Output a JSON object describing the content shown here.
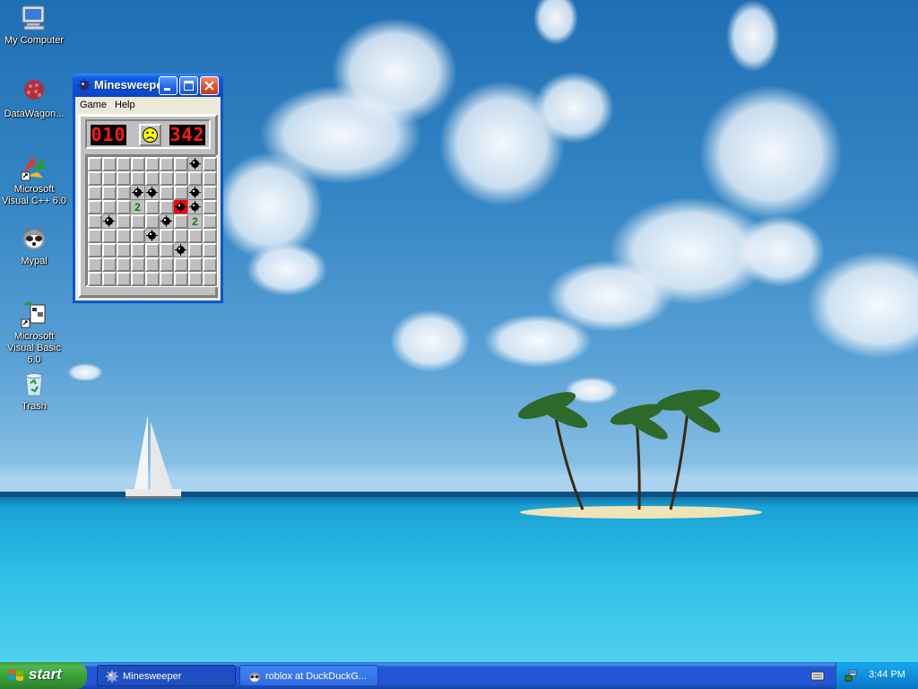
{
  "desktop": {
    "icons": [
      {
        "label": "My Computer",
        "icon": "my-computer-icon"
      },
      {
        "label": "DataWagon...",
        "icon": "datawagon-icon"
      },
      {
        "label": "Microsoft Visual C++ 6.0",
        "icon": "visual-cpp-icon"
      },
      {
        "label": "Mypal",
        "icon": "mypal-browser-icon"
      },
      {
        "label": "Microsoft Visual Basic 6.0",
        "icon": "visual-basic-icon"
      },
      {
        "label": "Trash",
        "icon": "recycle-bin-icon"
      }
    ]
  },
  "minesweeper": {
    "title": "Minesweeper",
    "title_visible": "Minesweeper...",
    "menu": [
      "Game",
      "Help"
    ],
    "mine_counter": "010",
    "timer": "342",
    "face": "sad",
    "board": [
      [
        "h",
        "h",
        "h",
        "h",
        "h",
        "h",
        "h",
        "m",
        "h"
      ],
      [
        "h",
        "h",
        "h",
        "h",
        "h",
        "h",
        "h",
        "h",
        "h"
      ],
      [
        "h",
        "h",
        "h",
        "m",
        "m",
        "h",
        "h",
        "m",
        "h"
      ],
      [
        "h",
        "h",
        "h",
        "2",
        "h",
        "h",
        "x",
        "m",
        "h"
      ],
      [
        "h",
        "m",
        "h",
        "h",
        "h",
        "m",
        "h",
        "2",
        "h"
      ],
      [
        "h",
        "h",
        "h",
        "h",
        "m",
        "h",
        "h",
        "h",
        "h"
      ],
      [
        "h",
        "h",
        "h",
        "h",
        "h",
        "h",
        "m",
        "h",
        "h"
      ],
      [
        "h",
        "h",
        "h",
        "h",
        "h",
        "h",
        "h",
        "h",
        "h"
      ],
      [
        "h",
        "h",
        "h",
        "h",
        "h",
        "h",
        "h",
        "h",
        "h"
      ]
    ]
  },
  "taskbar": {
    "start_label": "start",
    "tasks": [
      {
        "label": "Minesweeper",
        "active": true,
        "icon": "minesweeper-icon"
      },
      {
        "label": "roblox at DuckDuckG...",
        "active": false,
        "icon": "mypal-browser-icon"
      }
    ],
    "clock": "3:44 PM"
  },
  "colors": {
    "xp_blue": "#0a53d8",
    "start_green": "#379d37",
    "tray_blue": "#0d8ad8",
    "lcd_red": "#ff1a1a"
  }
}
